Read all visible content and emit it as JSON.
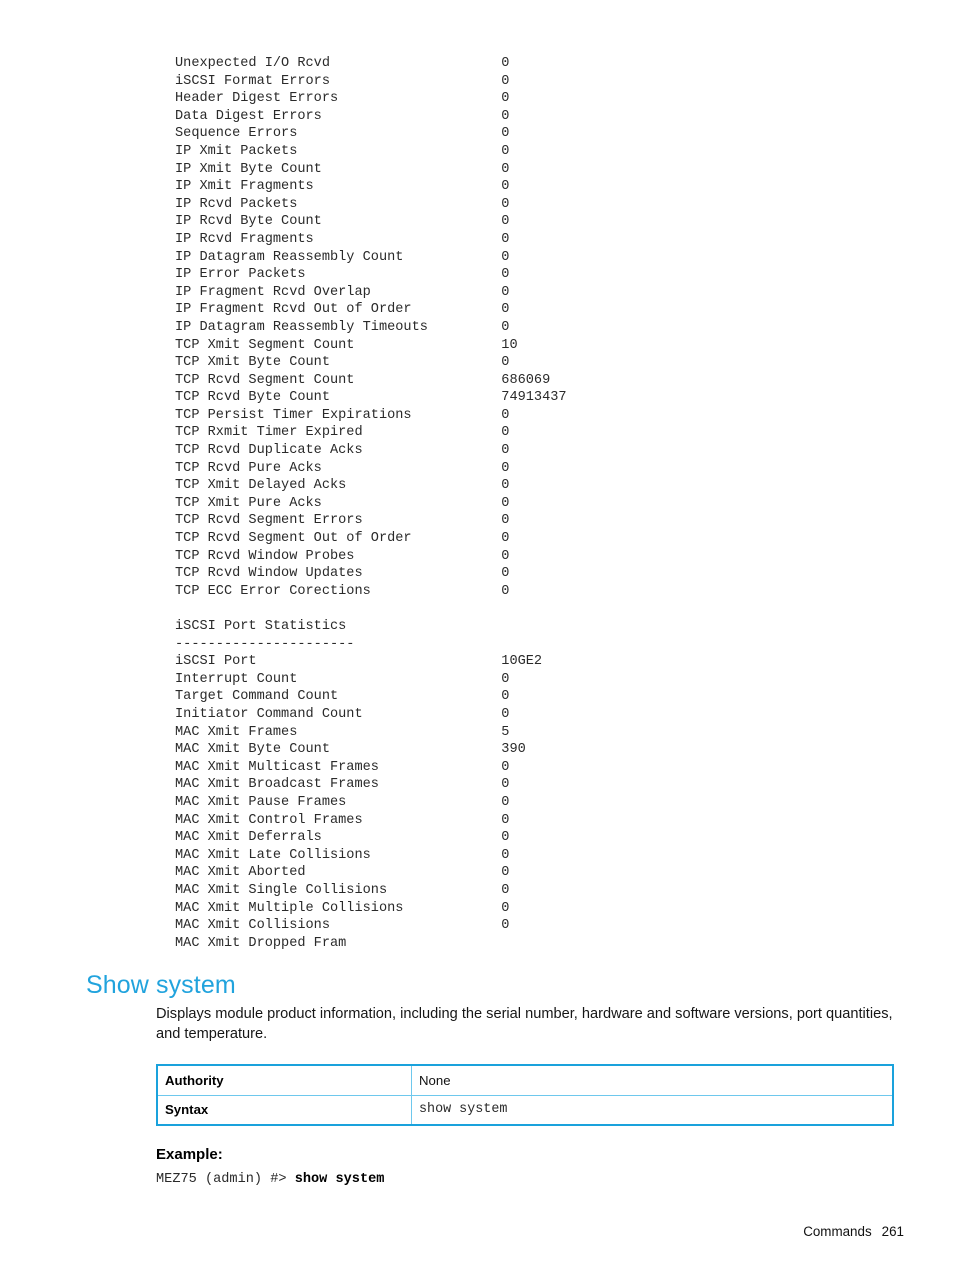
{
  "console": {
    "value_column": 40,
    "lines": [
      {
        "label": "Unexpected I/O Rcvd",
        "value": "0"
      },
      {
        "label": "iSCSI Format Errors",
        "value": "0"
      },
      {
        "label": "Header Digest Errors",
        "value": "0"
      },
      {
        "label": "Data Digest Errors",
        "value": "0"
      },
      {
        "label": "Sequence Errors",
        "value": "0"
      },
      {
        "label": "IP Xmit Packets",
        "value": "0"
      },
      {
        "label": "IP Xmit Byte Count",
        "value": "0"
      },
      {
        "label": "IP Xmit Fragments",
        "value": "0"
      },
      {
        "label": "IP Rcvd Packets",
        "value": "0"
      },
      {
        "label": "IP Rcvd Byte Count",
        "value": "0"
      },
      {
        "label": "IP Rcvd Fragments",
        "value": "0"
      },
      {
        "label": "IP Datagram Reassembly Count",
        "value": "0"
      },
      {
        "label": "IP Error Packets",
        "value": "0"
      },
      {
        "label": "IP Fragment Rcvd Overlap",
        "value": "0"
      },
      {
        "label": "IP Fragment Rcvd Out of Order",
        "value": "0"
      },
      {
        "label": "IP Datagram Reassembly Timeouts",
        "value": "0"
      },
      {
        "label": "TCP Xmit Segment Count",
        "value": "10"
      },
      {
        "label": "TCP Xmit Byte Count",
        "value": "0"
      },
      {
        "label": "TCP Rcvd Segment Count",
        "value": "686069"
      },
      {
        "label": "TCP Rcvd Byte Count",
        "value": "74913437"
      },
      {
        "label": "TCP Persist Timer Expirations",
        "value": "0"
      },
      {
        "label": "TCP Rxmit Timer Expired",
        "value": "0"
      },
      {
        "label": "TCP Rcvd Duplicate Acks",
        "value": "0"
      },
      {
        "label": "TCP Rcvd Pure Acks",
        "value": "0"
      },
      {
        "label": "TCP Xmit Delayed Acks",
        "value": "0"
      },
      {
        "label": "TCP Xmit Pure Acks",
        "value": "0"
      },
      {
        "label": "TCP Rcvd Segment Errors",
        "value": "0"
      },
      {
        "label": "TCP Rcvd Segment Out of Order",
        "value": "0"
      },
      {
        "label": "TCP Rcvd Window Probes",
        "value": "0"
      },
      {
        "label": "TCP Rcvd Window Updates",
        "value": "0"
      },
      {
        "label": "TCP ECC Error Corections",
        "value": "0"
      },
      {
        "label": "",
        "value": ""
      },
      {
        "label": "iSCSI Port Statistics",
        "value": ""
      },
      {
        "label": "----------------------",
        "value": ""
      },
      {
        "label": "iSCSI Port",
        "value": "10GE2"
      },
      {
        "label": "Interrupt Count",
        "value": "0"
      },
      {
        "label": "Target Command Count",
        "value": "0"
      },
      {
        "label": "Initiator Command Count",
        "value": "0"
      },
      {
        "label": "MAC Xmit Frames",
        "value": "5"
      },
      {
        "label": "MAC Xmit Byte Count",
        "value": "390"
      },
      {
        "label": "MAC Xmit Multicast Frames",
        "value": "0"
      },
      {
        "label": "MAC Xmit Broadcast Frames",
        "value": "0"
      },
      {
        "label": "MAC Xmit Pause Frames",
        "value": "0"
      },
      {
        "label": "MAC Xmit Control Frames",
        "value": "0"
      },
      {
        "label": "MAC Xmit Deferrals",
        "value": "0"
      },
      {
        "label": "MAC Xmit Late Collisions",
        "value": "0"
      },
      {
        "label": "MAC Xmit Aborted",
        "value": "0"
      },
      {
        "label": "MAC Xmit Single Collisions",
        "value": "0"
      },
      {
        "label": "MAC Xmit Multiple Collisions",
        "value": "0"
      },
      {
        "label": "MAC Xmit Collisions",
        "value": "0"
      },
      {
        "label": "MAC Xmit Dropped Fram",
        "value": ""
      }
    ]
  },
  "section": {
    "heading": "Show system",
    "description": "Displays module product information, including the serial number, hardware and software versions, port quantities, and temperature."
  },
  "info_table": {
    "rows": [
      {
        "label": "Authority",
        "value": "None",
        "mono": false
      },
      {
        "label": "Syntax",
        "value": "show system",
        "mono": true
      }
    ]
  },
  "example": {
    "label": "Example:",
    "prompt": "MEZ75 (admin) #> ",
    "command": "show system"
  },
  "footer": {
    "label": "Commands",
    "page_number": "261"
  },
  "colors": {
    "heading_blue": "#21a3dd",
    "table_border": "#1aa2dc",
    "table_inner_rule": "#6ec8ed"
  }
}
